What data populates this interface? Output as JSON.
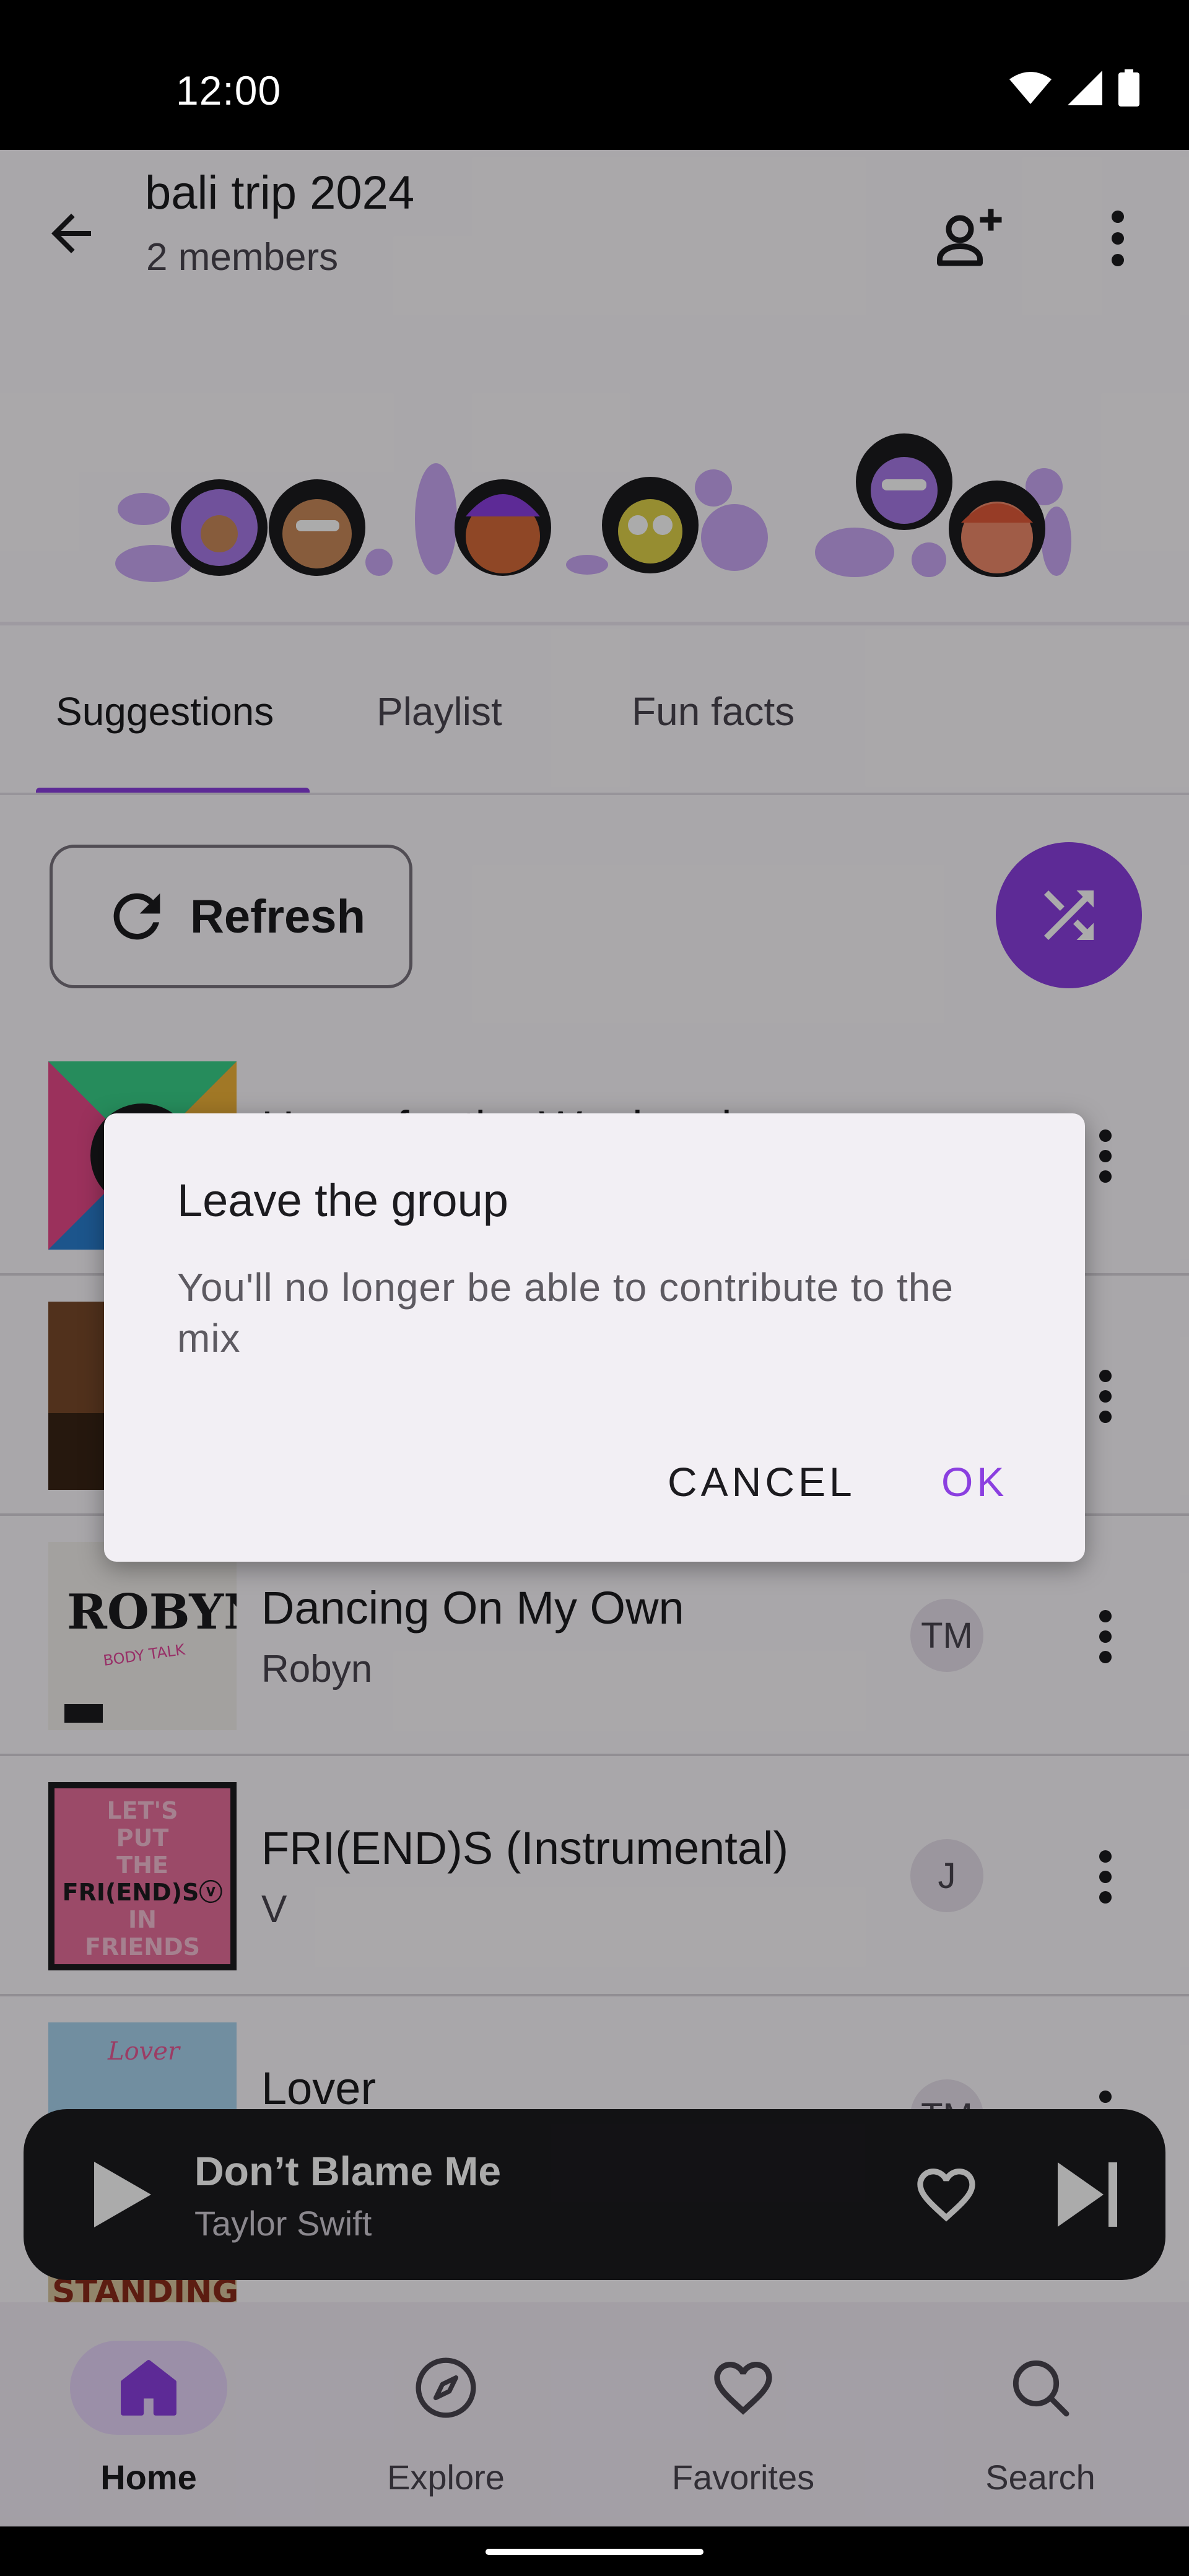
{
  "status_bar": {
    "time": "12:00"
  },
  "app_bar": {
    "title": "bali trip 2024",
    "subtitle": "2 members"
  },
  "tabs": [
    {
      "label": "Suggestions",
      "active": true
    },
    {
      "label": "Playlist",
      "active": false
    },
    {
      "label": "Fun facts",
      "active": false
    }
  ],
  "actions": {
    "refresh_label": "Refresh"
  },
  "tracks": [
    {
      "title": "Hours for the Weekend",
      "artist": "",
      "contributor": ""
    },
    {
      "title": "",
      "artist": "",
      "contributor": ""
    },
    {
      "title": "Dancing On My Own",
      "artist": "Robyn",
      "contributor": "TM"
    },
    {
      "title": "FRI(END)S (Instrumental)",
      "artist": "V",
      "contributor": "J"
    },
    {
      "title": "Lover",
      "artist": "",
      "contributor": "TM"
    }
  ],
  "album_art_text": {
    "robyn": "ROBYN",
    "friends": [
      "LET'S",
      "PUT",
      "THE",
      "FRI(END)Sⓥ",
      "IN",
      "FRIENDS"
    ],
    "lover": "Lover",
    "standing": "STANDING"
  },
  "mini_player": {
    "title": "Don’t Blame Me",
    "artist": "Taylor Swift"
  },
  "bottom_nav": [
    {
      "label": "Home",
      "icon": "home-icon",
      "active": true
    },
    {
      "label": "Explore",
      "icon": "compass-icon",
      "active": false
    },
    {
      "label": "Favorites",
      "icon": "heart-icon",
      "active": false
    },
    {
      "label": "Search",
      "icon": "search-icon",
      "active": false
    }
  ],
  "dialog": {
    "title": "Leave the group",
    "body": "You'll no longer be able to contribute to the mix",
    "cancel_label": "CANCEL",
    "ok_label": "OK"
  },
  "colors": {
    "accent": "#8b3fe0",
    "scrim": "rgba(0,0,0,0.33)",
    "surface": "#fdfafe",
    "dialog": "#f2eff4"
  }
}
